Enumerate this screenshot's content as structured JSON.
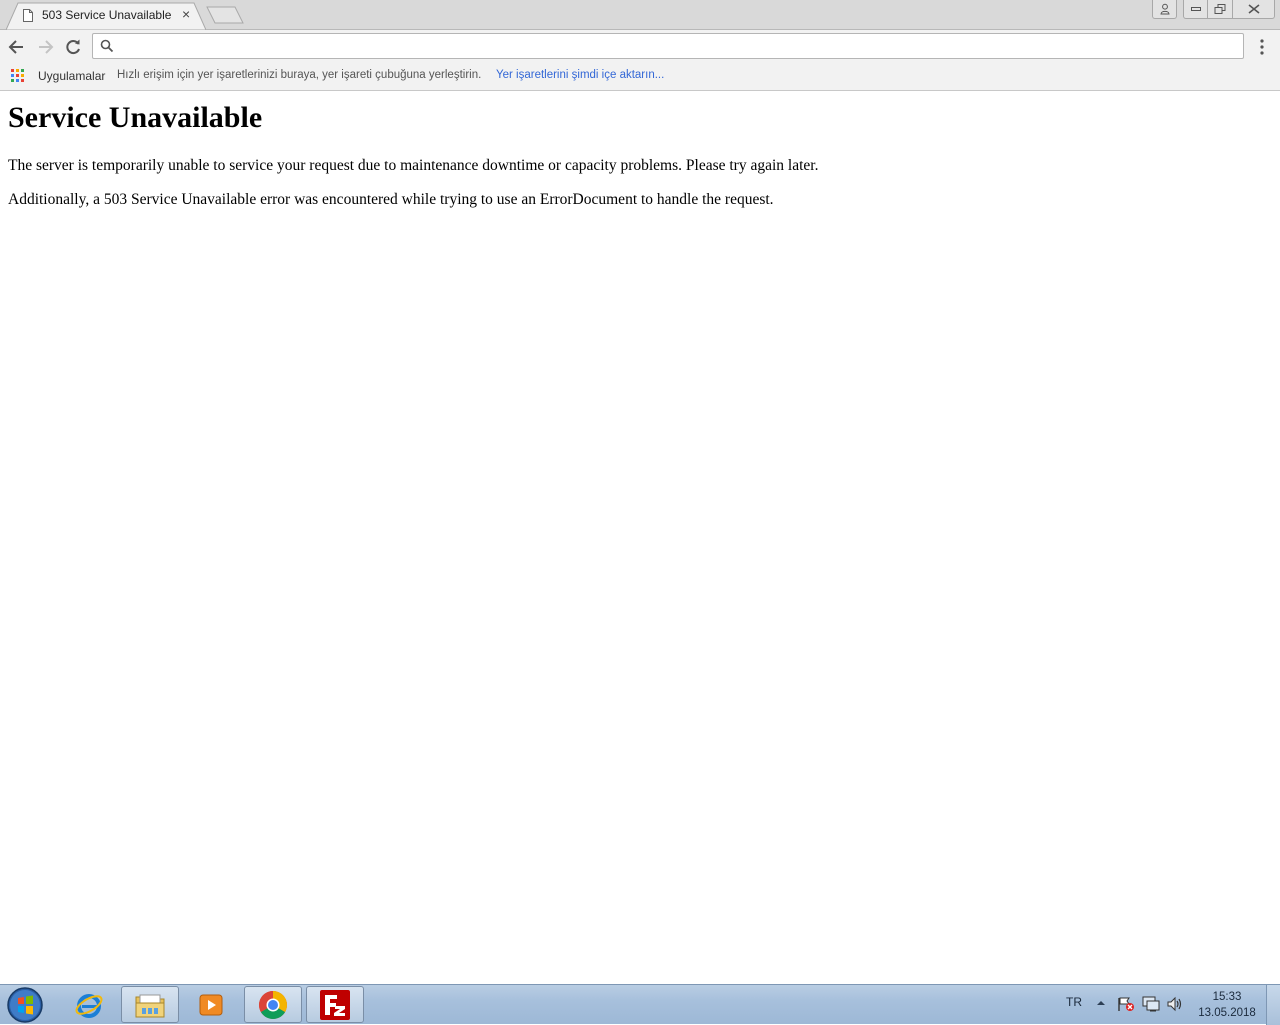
{
  "browser": {
    "tab_title": "503 Service Unavailable",
    "tab_close": "×",
    "omnibox_value": "",
    "omnibox_placeholder": "",
    "bookmarks": {
      "apps_label": "Uygulamalar",
      "hint": "Hızlı erişim için yer işaretlerinizi buraya, yer işareti çubuğuna yerleştirin.",
      "import_link": "Yer işaretlerini şimdi içe aktarın..."
    },
    "colors": {
      "link": "#3367d6",
      "chrome_bg": "#f2f2f2"
    }
  },
  "page": {
    "heading": "Service Unavailable",
    "paragraph1": "The server is temporarily unable to service your request due to maintenance downtime or capacity problems. Please try again later.",
    "paragraph2": "Additionally, a 503 Service Unavailable error was encountered while trying to use an ErrorDocument to handle the request."
  },
  "taskbar": {
    "items": [
      "start-orb-icon",
      "internet-explorer-icon",
      "file-explorer-icon",
      "media-player-icon",
      "chrome-icon",
      "filezilla-icon"
    ],
    "language": "TR",
    "time": "15:33",
    "date": "13.05.2018"
  }
}
